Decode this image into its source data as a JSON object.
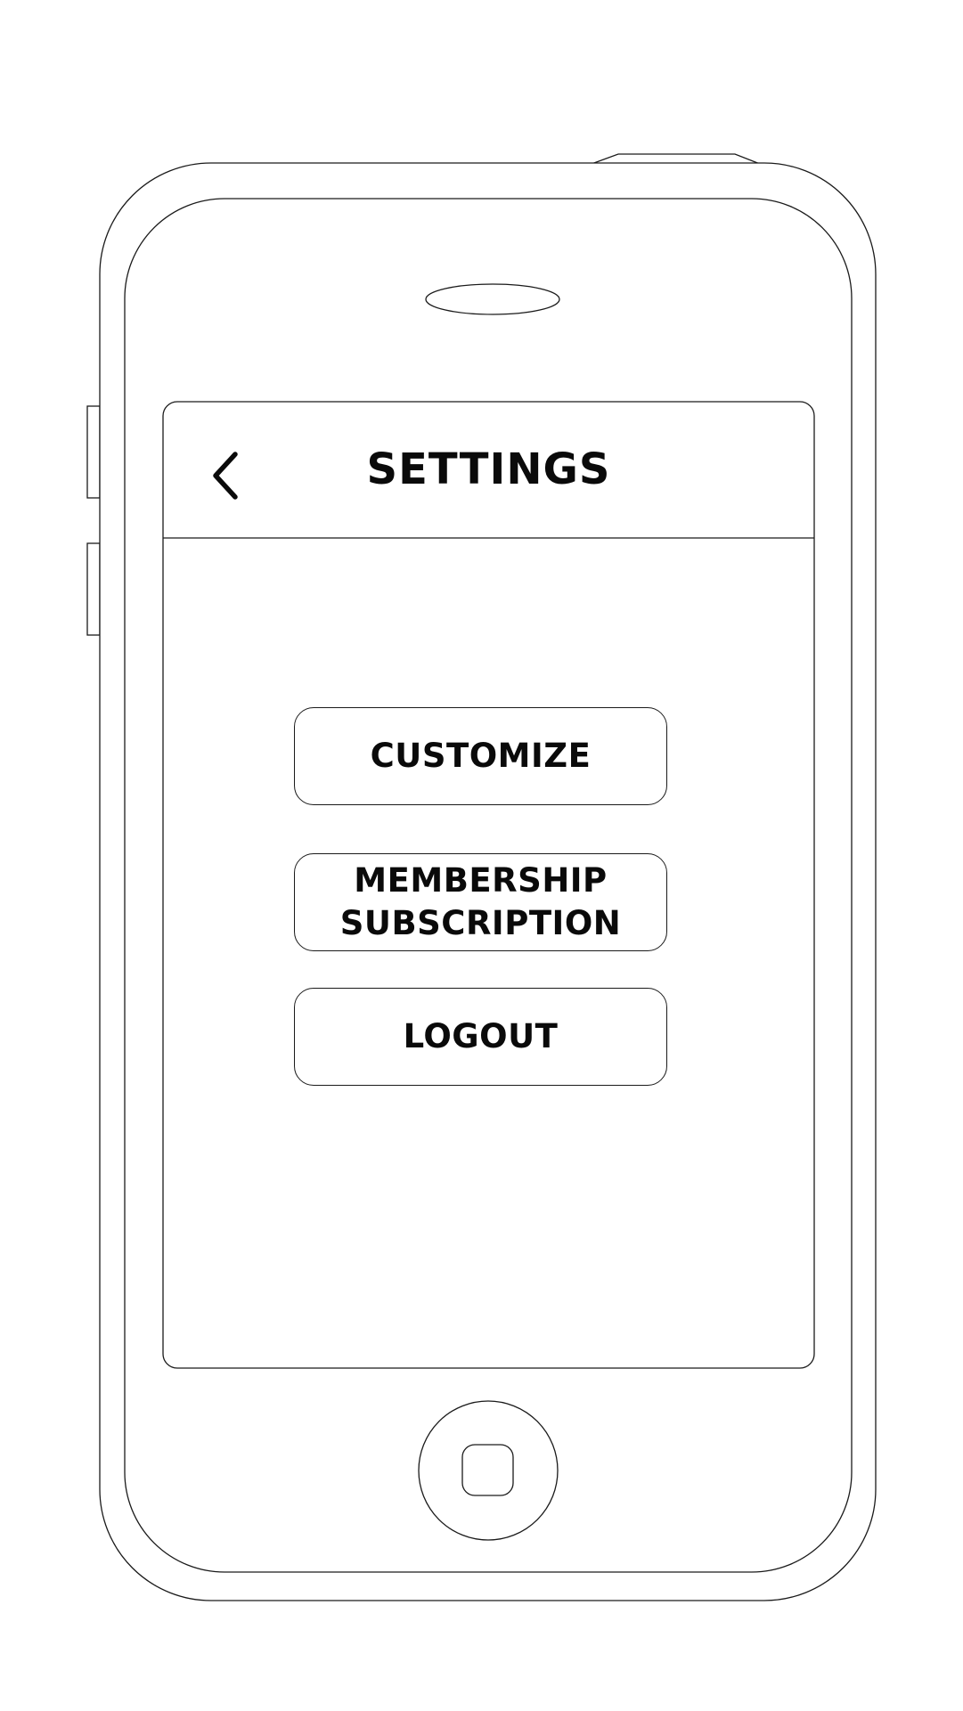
{
  "screen": {
    "title": "SETTINGS",
    "back_icon": "chevron-left-icon"
  },
  "menu": {
    "customize_label": "CUSTOMIZE",
    "membership_label": "MEMBERSHIP\nSUBSCRIPTION",
    "logout_label": "LOGOUT"
  },
  "device": {
    "earpiece_icon": "earpiece-slot",
    "home_icon": "home-button-icon"
  },
  "colors": {
    "stroke": "#1a1a1a",
    "text": "#0a0a0a",
    "background": "#ffffff"
  }
}
